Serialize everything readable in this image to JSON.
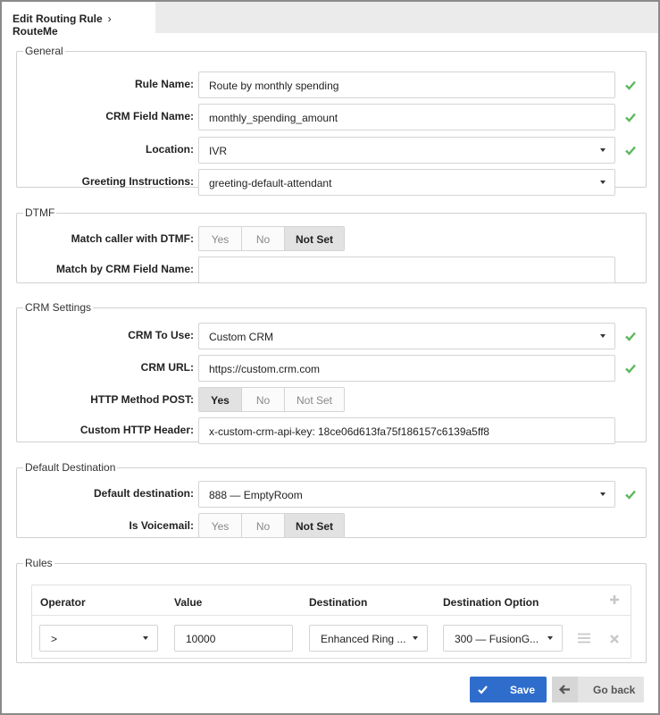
{
  "breadcrumb": {
    "title": "Edit Routing Rule",
    "separator": "›",
    "current": "RouteMe"
  },
  "general": {
    "legend": "General",
    "rule_name": {
      "label": "Rule Name:",
      "value": "Route by monthly spending"
    },
    "crm_field_name": {
      "label": "CRM Field Name:",
      "value": "monthly_spending_amount"
    },
    "location": {
      "label": "Location:",
      "value": "IVR"
    },
    "greeting": {
      "label": "Greeting Instructions:",
      "value": "greeting-default-attendant"
    }
  },
  "dtmf": {
    "legend": "DTMF",
    "match_caller": {
      "label": "Match caller with DTMF:",
      "options": [
        "Yes",
        "No",
        "Not Set"
      ],
      "selected": "Not Set"
    },
    "match_by_field": {
      "label": "Match by CRM Field Name:",
      "value": ""
    }
  },
  "crm": {
    "legend": "CRM Settings",
    "crm_to_use": {
      "label": "CRM To Use:",
      "value": "Custom CRM"
    },
    "crm_url": {
      "label": "CRM URL:",
      "value": "https://custom.crm.com"
    },
    "http_post": {
      "label": "HTTP Method POST:",
      "options": [
        "Yes",
        "No",
        "Not Set"
      ],
      "selected": "Yes"
    },
    "custom_header": {
      "label": "Custom HTTP Header:",
      "value": "x-custom-crm-api-key: 18ce06d613fa75f186157c6139a5ff8"
    }
  },
  "default_destination": {
    "legend": "Default Destination",
    "destination": {
      "label": "Default destination:",
      "value": "888  —  EmptyRoom"
    },
    "is_voicemail": {
      "label": "Is Voicemail:",
      "options": [
        "Yes",
        "No",
        "Not Set"
      ],
      "selected": "Not Set"
    }
  },
  "rules": {
    "legend": "Rules",
    "columns": [
      "Operator",
      "Value",
      "Destination",
      "Destination Option"
    ],
    "rows": [
      {
        "operator": ">",
        "value": "10000",
        "destination": "Enhanced Ring ...",
        "destination_option": "300  —  FusionG..."
      }
    ]
  },
  "actions": {
    "save": "Save",
    "go_back": "Go back"
  },
  "colors": {
    "accent": "#2f6dcc",
    "check": "#5cb85c"
  }
}
